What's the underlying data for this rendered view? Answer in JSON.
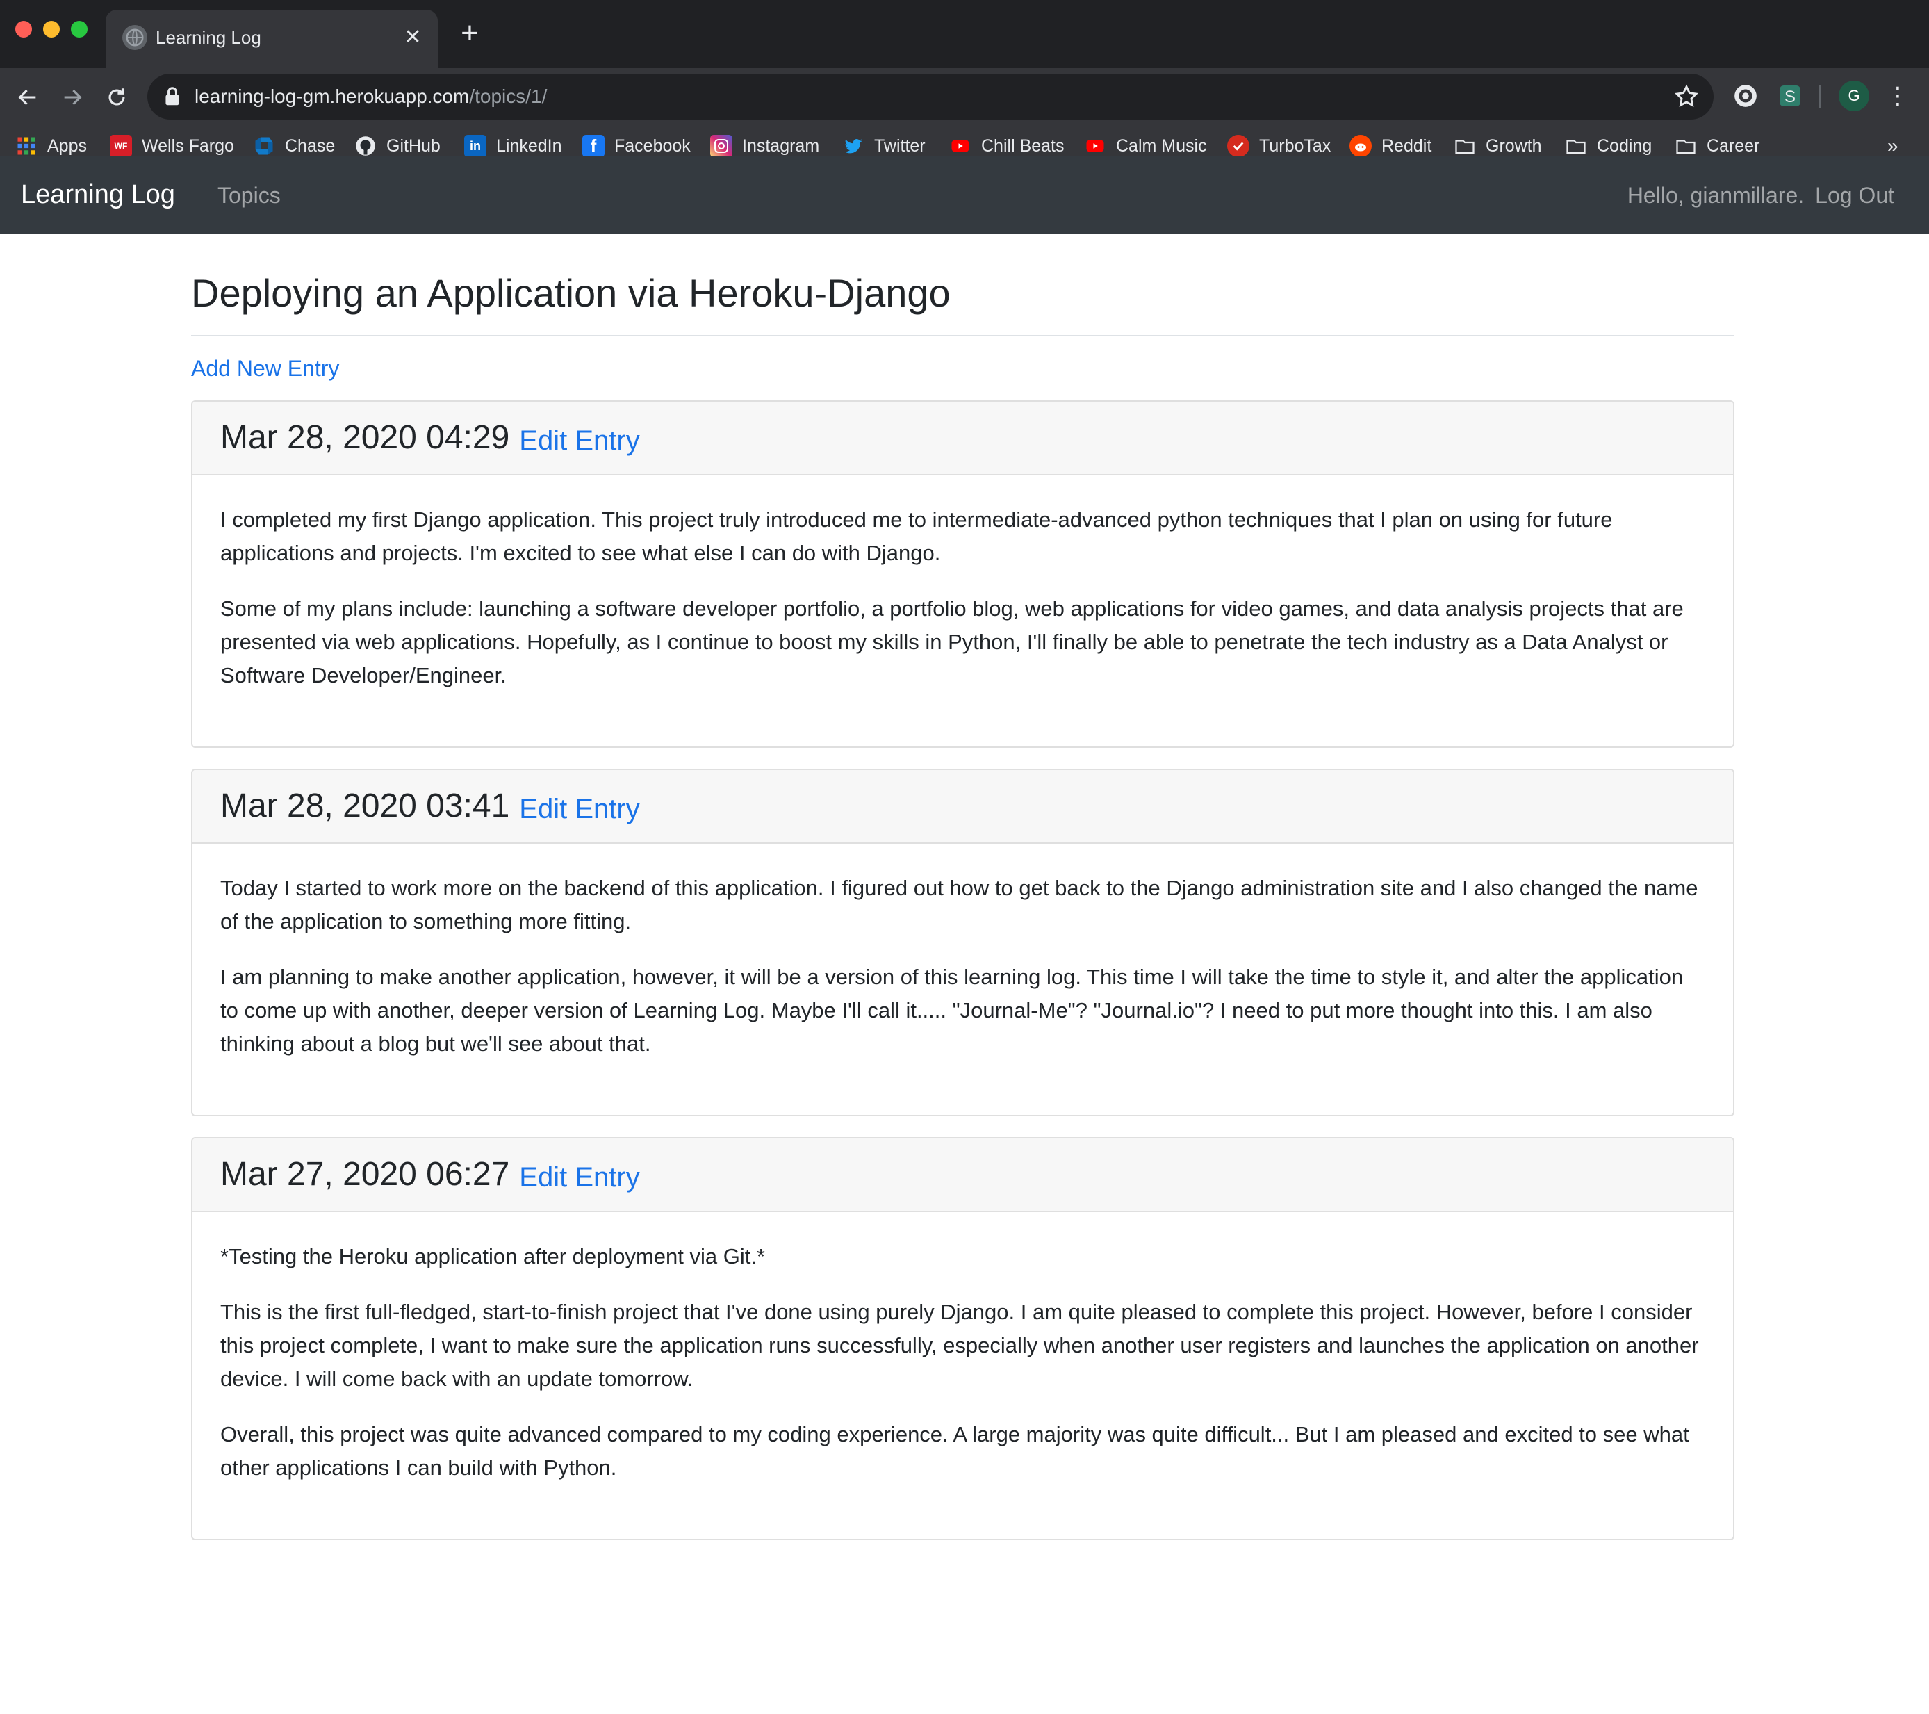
{
  "browser": {
    "tab_title": "Learning Log",
    "new_tab_label": "+",
    "close_label": "✕",
    "url_host": "learning-log-gm.herokuapp.com",
    "url_path": "/topics/1/",
    "avatar_letter": "G",
    "bookmarks": [
      {
        "label": "Apps",
        "icon": "apps-grid-icon",
        "color": "#4285f4"
      },
      {
        "label": "Wells Fargo",
        "icon": "wells-fargo-icon",
        "color": "#d71e28"
      },
      {
        "label": "Chase",
        "icon": "chase-icon",
        "color": "#117aca"
      },
      {
        "label": "GitHub",
        "icon": "github-icon",
        "color": "#24292e"
      },
      {
        "label": "LinkedIn",
        "icon": "linkedin-icon",
        "color": "#0a66c2"
      },
      {
        "label": "Facebook",
        "icon": "facebook-icon",
        "color": "#1877f2"
      },
      {
        "label": "Instagram",
        "icon": "instagram-icon",
        "color": "#c13584"
      },
      {
        "label": "Twitter",
        "icon": "twitter-icon",
        "color": "#1da1f2"
      },
      {
        "label": "Chill Beats",
        "icon": "youtube-icon",
        "color": "#ff0000"
      },
      {
        "label": "Calm Music",
        "icon": "youtube-icon",
        "color": "#ff0000"
      },
      {
        "label": "TurboTax",
        "icon": "turbotax-icon",
        "color": "#d52b1e"
      },
      {
        "label": "Reddit",
        "icon": "reddit-icon",
        "color": "#ff4500"
      },
      {
        "label": "Growth",
        "icon": "folder-icon",
        "color": "#9aa0a6"
      },
      {
        "label": "Coding",
        "icon": "folder-icon",
        "color": "#9aa0a6"
      },
      {
        "label": "Career",
        "icon": "folder-icon",
        "color": "#9aa0a6"
      }
    ],
    "bookmarks_more": "»"
  },
  "site_nav": {
    "brand": "Learning Log",
    "topics": "Topics",
    "greeting": "Hello, gianmillare.",
    "logout": "Log Out"
  },
  "topic": {
    "title": "Deploying an Application via Heroku-Django",
    "add_entry": "Add New Entry"
  },
  "entries": [
    {
      "date": "Mar 28, 2020 04:29",
      "edit": "Edit Entry",
      "paragraphs": [
        "I completed my first Django application. This project truly introduced me to intermediate-advanced python techniques that I plan on using for future applications and projects. I'm excited to see what else I can do with Django.",
        "Some of my plans include: launching a software developer portfolio, a portfolio blog, web applications for video games, and data analysis projects that are presented via web applications. Hopefully, as I continue to boost my skills in Python, I'll finally be able to penetrate the tech industry as a Data Analyst or Software Developer/Engineer."
      ]
    },
    {
      "date": "Mar 28, 2020 03:41",
      "edit": "Edit Entry",
      "paragraphs": [
        "Today I started to work more on the backend of this application. I figured out how to get back to the Django administration site and I also changed the name of the application to something more fitting.",
        "I am planning to make another application, however, it will be a version of this learning log. This time I will take the time to style it, and alter the application to come up with another, deeper version of Learning Log. Maybe I'll call it..... \"Journal-Me\"? \"Journal.io\"? I need to put more thought into this. I am also thinking about a blog but we'll see about that."
      ]
    },
    {
      "date": "Mar 27, 2020 06:27",
      "edit": "Edit Entry",
      "paragraphs": [
        "*Testing the Heroku application after deployment via Git.*",
        "This is the first full-fledged, start-to-finish project that I've done using purely Django. I am quite pleased to complete this project. However, before I consider this project complete, I want to make sure the application runs successfully, especially when another user registers and launches the application on another device. I will come back with an update tomorrow.",
        "Overall, this project was quite advanced compared to my coding experience. A large majority was quite difficult... But I am pleased and excited to see what other applications I can build with Python."
      ]
    }
  ],
  "colors": {
    "link": "#1a73e8",
    "navbar": "#343a40",
    "chrome_dark": "#202124",
    "chrome_toolbar": "#35363a"
  }
}
